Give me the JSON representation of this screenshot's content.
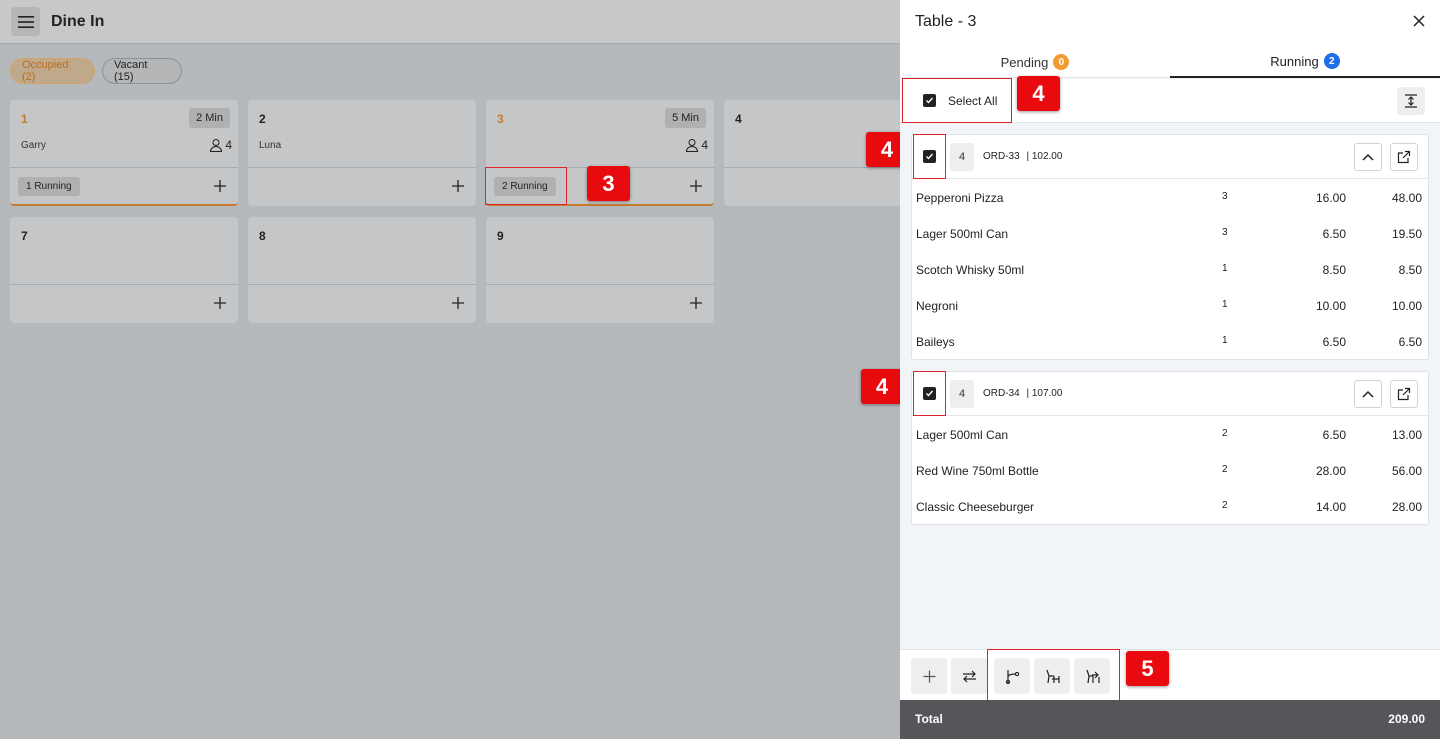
{
  "app": {
    "title": "Dine In"
  },
  "filters": {
    "occupied": "Occupied (2)",
    "vacant": "Vacant (15)"
  },
  "tables": [
    {
      "number": "1",
      "time": "2 Min",
      "person": "Garry",
      "guests": "4",
      "running": "1 Running"
    },
    {
      "number": "2",
      "person": "Luna"
    },
    {
      "number": "3",
      "time": "5 Min",
      "guests": "4",
      "running": "2 Running"
    },
    {
      "number": "4"
    },
    {
      "number": "7"
    },
    {
      "number": "8"
    },
    {
      "number": "9"
    }
  ],
  "panel": {
    "title": "Table - 3",
    "tabs": [
      {
        "label": "Pending",
        "count": "0"
      },
      {
        "label": "Running",
        "count": "2"
      }
    ],
    "select_all_label": "Select All",
    "orders": [
      {
        "guests": "4",
        "id": "ORD-33",
        "amount": "| 102.00",
        "items": [
          {
            "name": "Pepperoni Pizza",
            "qty": "3",
            "price": "16.00",
            "total": "48.00"
          },
          {
            "name": "Lager 500ml Can",
            "qty": "3",
            "price": "6.50",
            "total": "19.50"
          },
          {
            "name": "Scotch Whisky 50ml",
            "qty": "1",
            "price": "8.50",
            "total": "8.50"
          },
          {
            "name": "Negroni",
            "qty": "1",
            "price": "10.00",
            "total": "10.00"
          },
          {
            "name": "Baileys",
            "qty": "1",
            "price": "6.50",
            "total": "6.50"
          }
        ]
      },
      {
        "guests": "4",
        "id": "ORD-34",
        "amount": "| 107.00",
        "items": [
          {
            "name": "Lager 500ml Can",
            "qty": "2",
            "price": "6.50",
            "total": "13.00"
          },
          {
            "name": "Red Wine 750ml Bottle",
            "qty": "2",
            "price": "28.00",
            "total": "56.00"
          },
          {
            "name": "Classic Cheeseburger",
            "qty": "2",
            "price": "14.00",
            "total": "28.00"
          }
        ]
      }
    ],
    "total_label": "Total",
    "total_value": "209.00"
  },
  "callouts": {
    "c3": "3",
    "c4a": "4",
    "c4b": "4",
    "c4c": "4",
    "c5": "5"
  },
  "colors": {
    "accent_orange": "#f29a2e",
    "accent_blue": "#1e6fe8",
    "annotation_red": "#e80a0f",
    "total_bar": "#57545a"
  }
}
